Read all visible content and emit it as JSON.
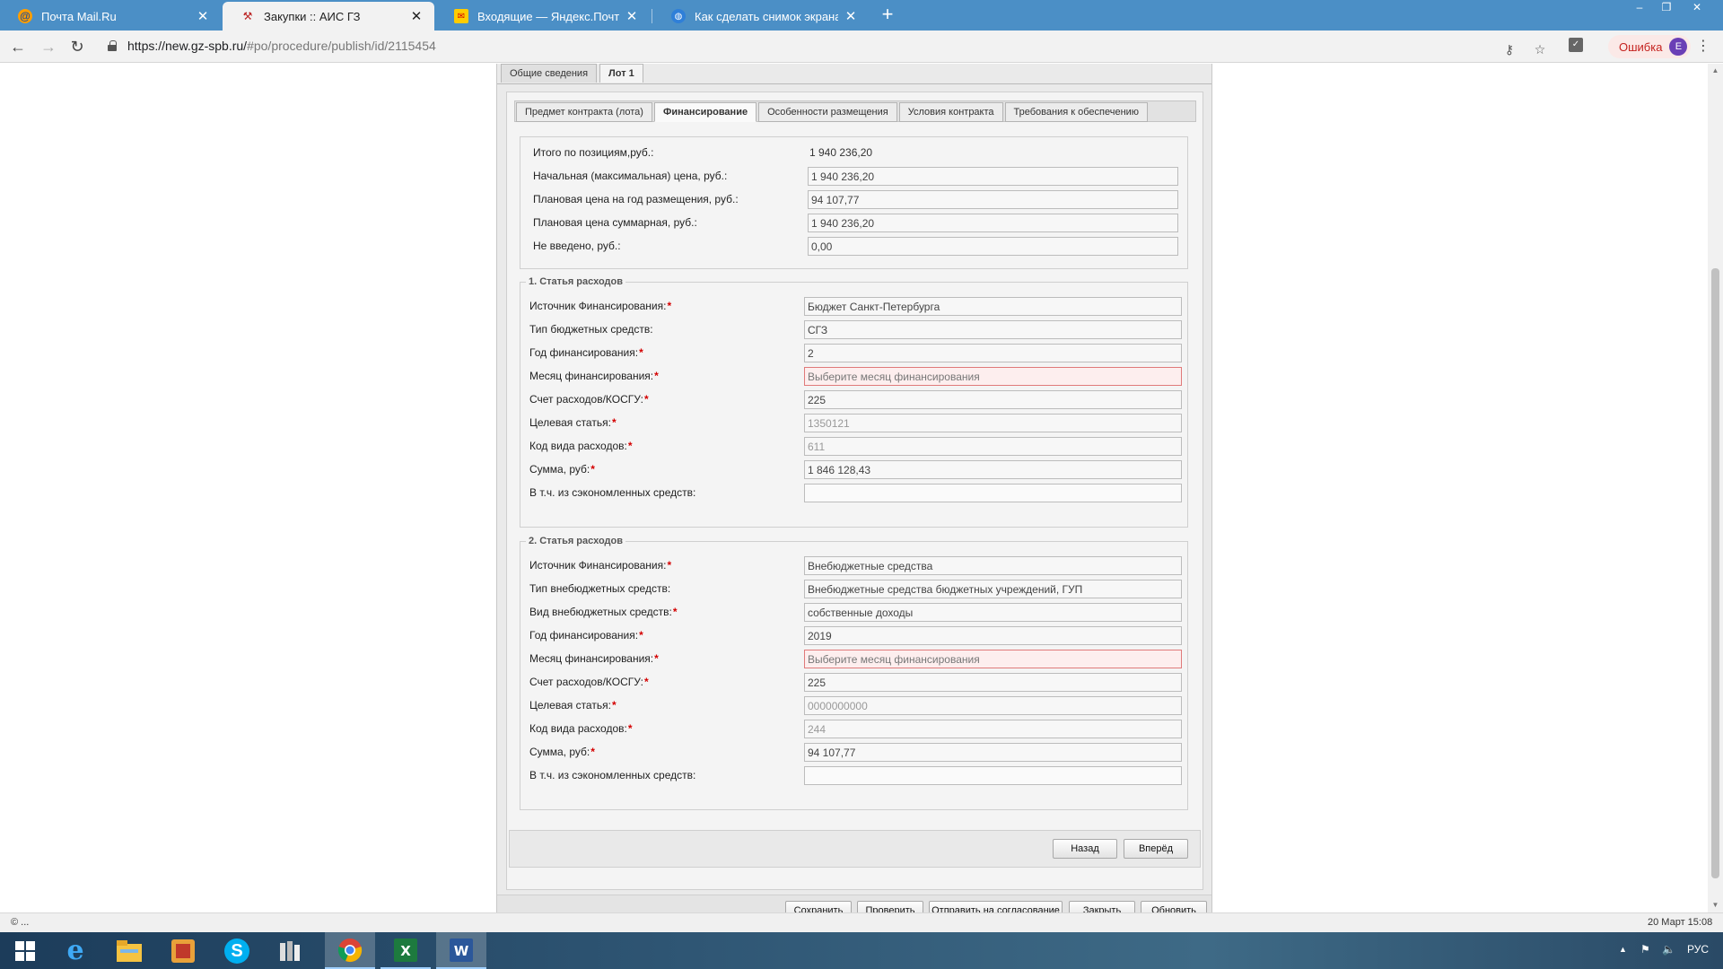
{
  "browser": {
    "tabs": [
      {
        "title": "Почта Mail.Ru",
        "icon": "mailru-icon"
      },
      {
        "title": "Закупки :: АИС ГЗ",
        "icon": "tools-icon",
        "active": true
      },
      {
        "title": "Входящие — Яндекс.Почта",
        "icon": "yandex-mail-icon"
      },
      {
        "title": "Как сделать снимок экрана (скр",
        "icon": "globe-icon"
      }
    ],
    "url_host": "https://new.gz-spb.ru/",
    "url_path": "#po/procedure/publish/id/2115454",
    "error_label": "Ошибка",
    "avatar_letter": "E"
  },
  "page": {
    "top_tabs": [
      "Общие сведения",
      "Лот 1"
    ],
    "sub_tabs": [
      "Предмет контракта (лота)",
      "Финансирование",
      "Особенности размещения",
      "Условия контракта",
      "Требования к обеспечению"
    ],
    "summary": [
      {
        "label": "Итого по позициям,руб.:",
        "value": "1 940 236,20"
      },
      {
        "label": "Начальная (максимальная) цена, руб.:",
        "value": "1 940 236,20"
      },
      {
        "label": "Плановая цена на год размещения, руб.:",
        "value": "94 107,77"
      },
      {
        "label": "Плановая цена суммарная, руб.:",
        "value": "1 940 236,20"
      },
      {
        "label": "Не введено, руб.:",
        "value": "0,00"
      }
    ],
    "expense1": {
      "legend": "1. Статья расходов",
      "rows": [
        {
          "label": "Источник Финансирования:",
          "value": "Бюджет Санкт-Петербурга"
        },
        {
          "label": "Тип бюджетных средств:",
          "value": "СГЗ"
        },
        {
          "label": "Год финансирования:",
          "value": "2"
        },
        {
          "label": "Месяц финансирования:",
          "value": "Выберите месяц финансирования"
        },
        {
          "label": "Счет расходов/КОСГУ:",
          "value": "225"
        },
        {
          "label": "Целевая статья:",
          "value": "1350121"
        },
        {
          "label": "Код вида расходов:",
          "value": "611"
        },
        {
          "label": "Сумма, руб:",
          "value": "1 846 128,43"
        },
        {
          "label": "В т.ч. из сэкономленных средств:",
          "value": ""
        }
      ]
    },
    "expense2": {
      "legend": "2. Статья расходов",
      "rows": [
        {
          "label": "Источник Финансирования:",
          "value": "Внебюджетные средства"
        },
        {
          "label": "Тип внебюджетных средств:",
          "value": "Внебюджетные средства бюджетных учреждений, ГУП"
        },
        {
          "label": "Вид внебюджетных средств:",
          "value": "собственные доходы"
        },
        {
          "label": "Год финансирования:",
          "value": "2019"
        },
        {
          "label": "Месяц финансирования:",
          "value": "Выберите месяц финансирования"
        },
        {
          "label": "Счет расходов/КОСГУ:",
          "value": "225"
        },
        {
          "label": "Целевая статья:",
          "value": "0000000000"
        },
        {
          "label": "Код вида расходов:",
          "value": "244"
        },
        {
          "label": "Сумма, руб:",
          "value": "94 107,77"
        },
        {
          "label": "В т.ч. из сэкономленных средств:",
          "value": ""
        }
      ]
    },
    "nav_buttons": {
      "back": "Назад",
      "forward": "Вперёд"
    },
    "action_buttons": [
      "Сохранить",
      "Проверить",
      "Отправить на согласование",
      "Закрыть",
      "Обновить"
    ]
  },
  "statusbar": {
    "left": "© ...",
    "right": "20 Март 15:08"
  },
  "taskbar": {
    "apps": [
      "start-icon",
      "internet-explorer-icon",
      "file-explorer-icon",
      "photo-app-icon",
      "skype-icon",
      "archive-app-icon",
      "chrome-icon",
      "excel-icon",
      "word-icon"
    ],
    "lang": "РУС"
  },
  "colors": {
    "browser_tab_bar": "#4b8fc6",
    "required_marker": "#d40000",
    "invalid_border": "#e07a7a"
  }
}
